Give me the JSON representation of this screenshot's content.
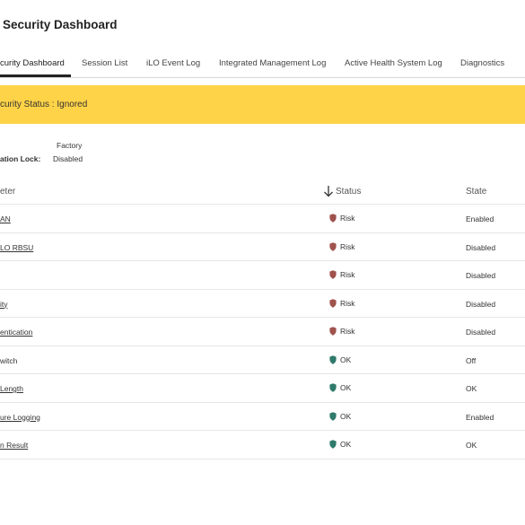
{
  "page": {
    "title": "Security Dashboard"
  },
  "tabs": [
    {
      "label": "curity Dashboard",
      "active": true
    },
    {
      "label": "Session List",
      "active": false
    },
    {
      "label": "iLO Event Log",
      "active": false
    },
    {
      "label": "Integrated Management Log",
      "active": false
    },
    {
      "label": "Active Health System Log",
      "active": false
    },
    {
      "label": "Diagnostics",
      "active": false
    }
  ],
  "banner": {
    "text": "curity Status : Ignored",
    "color": "#ffd347"
  },
  "info": {
    "state_value": "Factory",
    "lock_label": "ation Lock:",
    "lock_value": "Disabled"
  },
  "table": {
    "columns": {
      "parameter": "eter",
      "status": "Status",
      "state": "State"
    },
    "rows": [
      {
        "parameter": "AN",
        "link": true,
        "status": "Risk",
        "state": "Enabled"
      },
      {
        "parameter": "LO RBSU",
        "link": true,
        "status": "Risk",
        "state": "Disabled"
      },
      {
        "parameter": "",
        "link": true,
        "status": "Risk",
        "state": "Disabled"
      },
      {
        "parameter": "ity",
        "link": true,
        "status": "Risk",
        "state": "Disabled"
      },
      {
        "parameter": "entication",
        "link": true,
        "status": "Risk",
        "state": "Disabled"
      },
      {
        "parameter": "witch",
        "link": false,
        "status": "OK",
        "state": "Off"
      },
      {
        "parameter": "Length",
        "link": true,
        "status": "OK",
        "state": "OK"
      },
      {
        "parameter": "ure Logging",
        "link": true,
        "status": "OK",
        "state": "Enabled"
      },
      {
        "parameter": "n Result",
        "link": true,
        "status": "OK",
        "state": "OK"
      }
    ]
  },
  "icons": {
    "risk": "shield-risk-icon",
    "ok": "shield-ok-icon",
    "sort": "arrow-down-icon"
  },
  "colors": {
    "risk": "#a0524d",
    "ok": "#2f7a6a"
  }
}
